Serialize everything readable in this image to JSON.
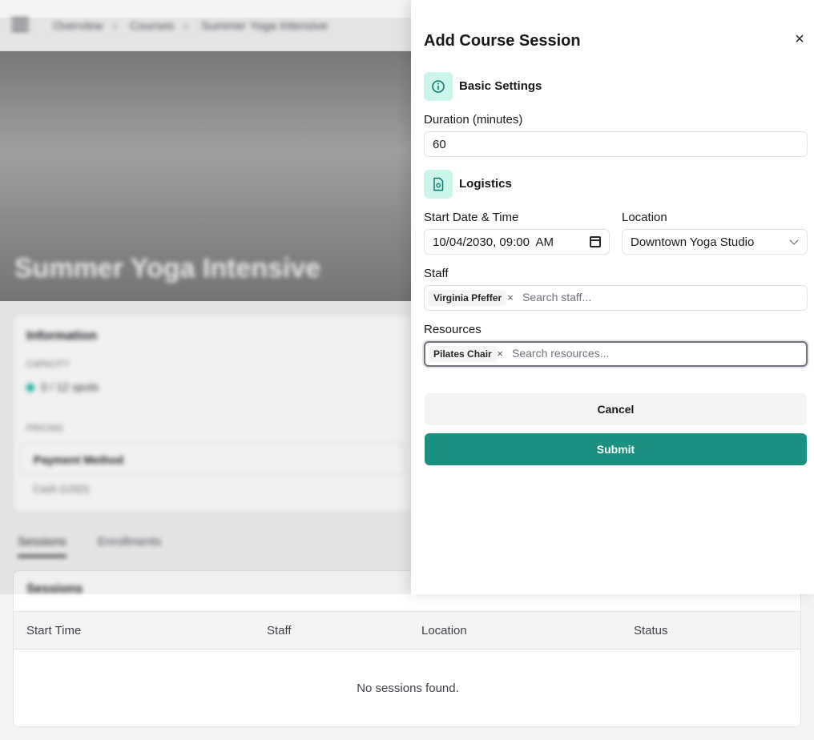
{
  "background": {
    "breadcrumbs": [
      "Overview",
      "Courses",
      "Summer Yoga Intensive"
    ],
    "hero_title": "Summer Yoga Intensive",
    "info": {
      "title": "Information",
      "capacity_label": "Capacity",
      "capacity_value": "0 / 12 spots",
      "pricing_label": "Pricing",
      "payment_title": "Payment Method",
      "payment_sub": "Cash (USD)"
    },
    "tabs": [
      "Sessions",
      "Enrollments"
    ],
    "sessions": {
      "title": "Sessions",
      "columns": [
        "Start Time",
        "Staff",
        "Location",
        "Status"
      ],
      "empty_message": "No sessions found."
    }
  },
  "drawer": {
    "title": "Add Course Session",
    "close_symbol": "×",
    "basic_section": "Basic Settings",
    "duration_label": "Duration (minutes)",
    "duration_value": "60",
    "logistics_section": "Logistics",
    "start_label": "Start Date & Time",
    "start_value": "10/04/2030, 09:00  AM",
    "location_label": "Location",
    "location_value": "Downtown Yoga Studio",
    "staff_label": "Staff",
    "staff_chip": "Virginia Pfeffer",
    "staff_placeholder": "Search staff...",
    "resources_label": "Resources",
    "resource_chip": "Pilates Chair",
    "resources_placeholder": "Search resources...",
    "chip_remove": "×",
    "cancel_label": "Cancel",
    "submit_label": "Submit"
  },
  "colors": {
    "accent": "#1a9080",
    "section_icon_bg": "#ccf5ec",
    "section_icon_fg": "#0f766e"
  },
  "icons": {
    "basic_section": "info-icon",
    "logistics_section": "document-icon",
    "start_field": "calendar-icon",
    "location_field": "chevron-down-icon"
  }
}
